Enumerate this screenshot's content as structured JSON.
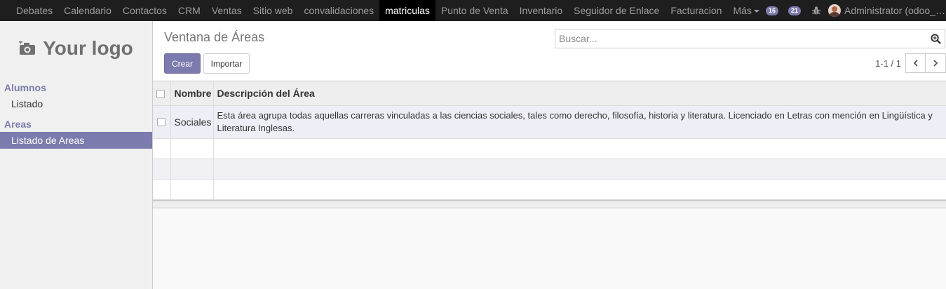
{
  "topbar": {
    "menu": [
      {
        "label": "Debates",
        "active": false
      },
      {
        "label": "Calendario",
        "active": false
      },
      {
        "label": "Contactos",
        "active": false
      },
      {
        "label": "CRM",
        "active": false
      },
      {
        "label": "Ventas",
        "active": false
      },
      {
        "label": "Sitio web",
        "active": false
      },
      {
        "label": "convalidaciones",
        "active": false
      },
      {
        "label": "matriculas",
        "active": true
      },
      {
        "label": "Punto de Venta",
        "active": false
      },
      {
        "label": "Inventario",
        "active": false
      },
      {
        "label": "Seguidor de Enlace",
        "active": false
      },
      {
        "label": "Facturacion",
        "active": false
      }
    ],
    "more_label": "Más",
    "badges": {
      "messages": "16",
      "chat": "21"
    },
    "user_name": "Administrator (odoo_te..."
  },
  "sidebar": {
    "logo_text": "Your logo",
    "sections": [
      {
        "title": "Alumnos",
        "items": [
          {
            "label": "Listado",
            "active": false
          }
        ]
      },
      {
        "title": "Areas",
        "items": [
          {
            "label": "Listado de Areas",
            "active": true
          }
        ]
      }
    ]
  },
  "control_panel": {
    "title": "Ventana de Áreas",
    "search_placeholder": "Buscar...",
    "create_label": "Crear",
    "import_label": "Importar",
    "pager_value": "1-1 / 1"
  },
  "table": {
    "columns": [
      "Nombre",
      "Descripción del Área"
    ],
    "rows": [
      {
        "nombre": "Sociales",
        "descripcion": " Esta área agrupa todas aquellas carreras vinculadas a las ciencias sociales, tales como derecho, filosofía, historia y literatura. Licenciado en Letras con mención en Lingüística y Literatura Inglesas."
      }
    ]
  },
  "colors": {
    "navbar": "#1e1e1e",
    "accent": "#7c7bad"
  }
}
